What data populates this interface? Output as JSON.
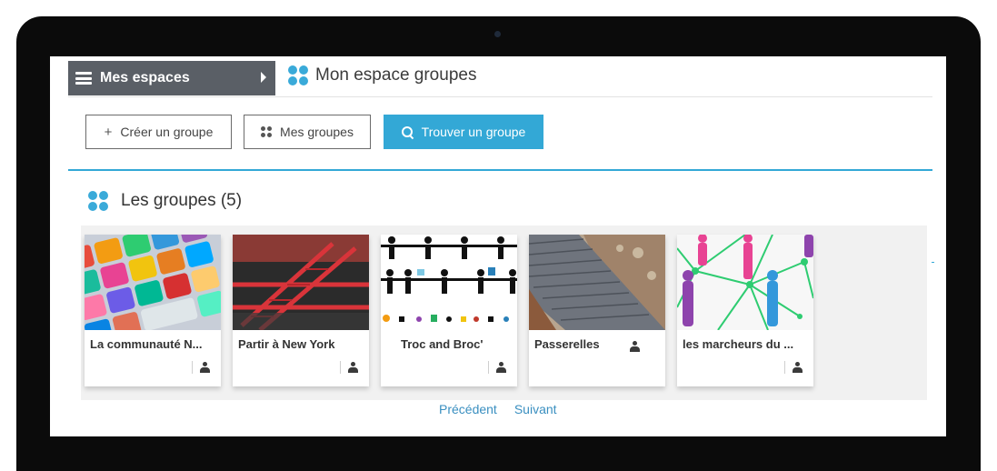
{
  "sidebar_toggle": {
    "label": "Mes espaces"
  },
  "header": {
    "title": "Mon espace groupes"
  },
  "actions": {
    "create_label": "Créer un groupe",
    "mine_label": "Mes groupes",
    "find_label": "Trouver un groupe",
    "create_icon": "plus-icon",
    "mine_icon": "groups-icon",
    "find_icon": "search-icon"
  },
  "section": {
    "title": "Les groupes (5)"
  },
  "groups": [
    {
      "name": "La communauté N...",
      "image": "colorful-app-keyboard"
    },
    {
      "name": "Partir à New York",
      "image": "red-fire-escape"
    },
    {
      "name": "Troc and Broc'",
      "image": "people-pictogram-pattern"
    },
    {
      "name": "Passerelles",
      "image": "rocky-slate-bridge"
    },
    {
      "name": "les marcheurs du ...",
      "image": "network-silhouettes"
    }
  ],
  "pager": {
    "prev": "Précédent",
    "next": "Suivant"
  },
  "colors": {
    "accent": "#33a8d6",
    "menu_bg": "#5a5f66",
    "bezel": "#0b0b0b"
  }
}
